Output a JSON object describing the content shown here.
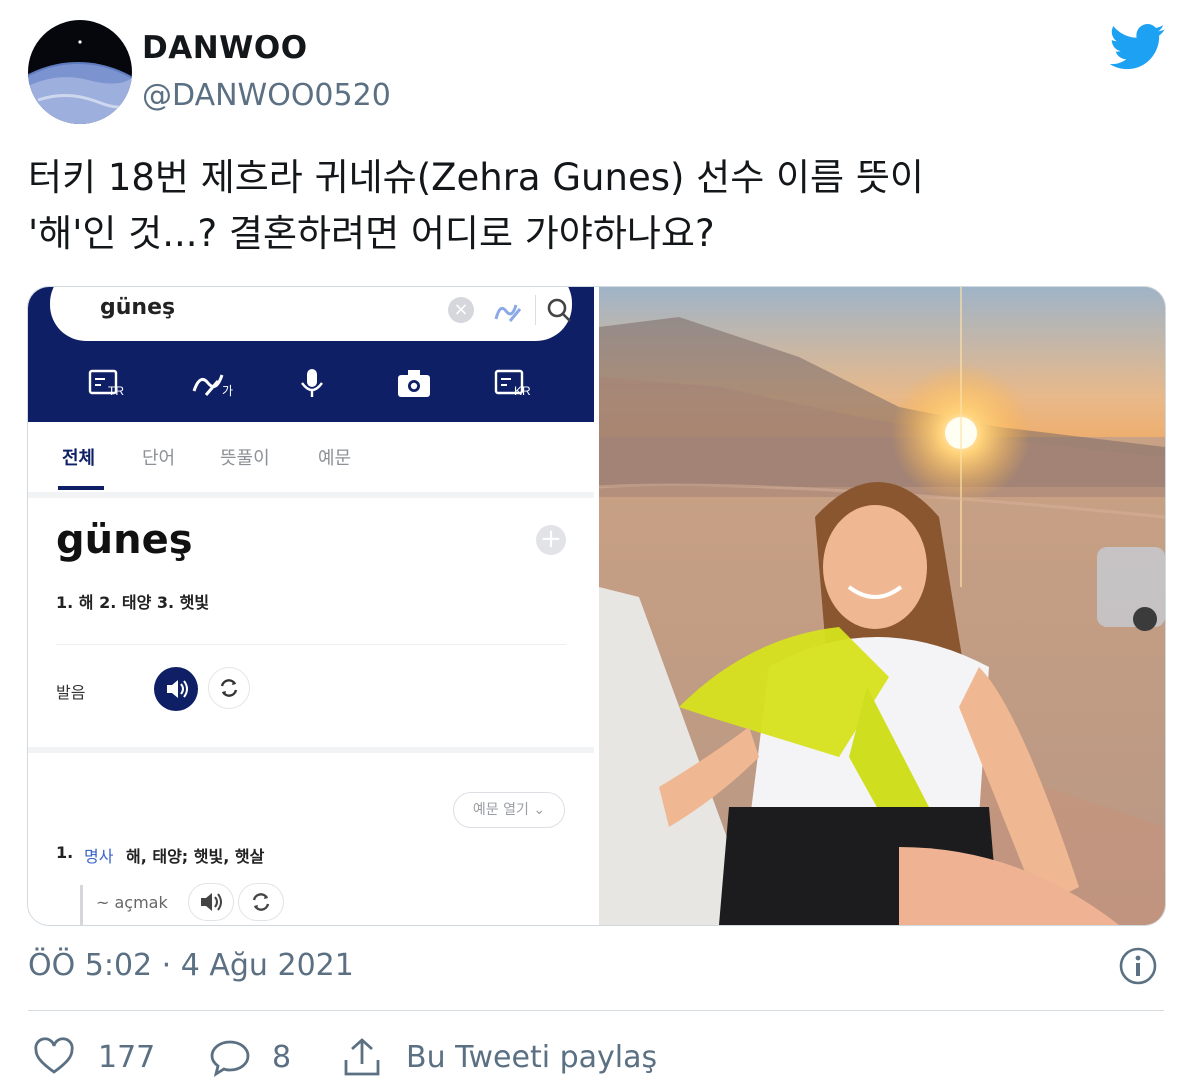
{
  "author": {
    "display_name": "DANWOO",
    "handle": "@DANWOO0520",
    "avatar_icon": "earth-from-space-avatar"
  },
  "tweet": {
    "text": "터키 18번 제흐라 귀네슈(Zehra Gunes) 선수 이름 뜻이\n'해'인 것...? 결혼하려면 어디로 가야하나요?"
  },
  "dictionary_screenshot": {
    "search_value": "güneş",
    "search_clear_icon": "close-icon",
    "toolbar_icons": [
      "keyboard-tr-icon",
      "handwriting-icon",
      "microphone-icon",
      "camera-icon",
      "keyboard-kr-icon"
    ],
    "toolbar_labels": [
      "TR",
      "가",
      "KR"
    ],
    "tabs": [
      "전체",
      "단어",
      "뜻풀이",
      "예문"
    ],
    "active_tab": "전체",
    "entry_word": "güneş",
    "entry_meanings": "1. 해 2. 태양 3. 햇빛",
    "pronunciation_label": "발음",
    "examples_button": "예문 열기",
    "sense": {
      "number": "1.",
      "part_of_speech": "명사",
      "definition": "해, 태양; 햇빛, 햇살"
    },
    "sub_phrase": "~ açmak"
  },
  "footer": {
    "timestamp": "ÖÖ 5:02 · 4 Ağu 2021",
    "like_count": "177",
    "reply_count": "8",
    "share_label": "Bu Tweeti paylaş"
  },
  "colors": {
    "twitter_blue": "#1da1f2",
    "dictionary_navy": "#0e1f66",
    "secondary_text": "#5b7083"
  }
}
